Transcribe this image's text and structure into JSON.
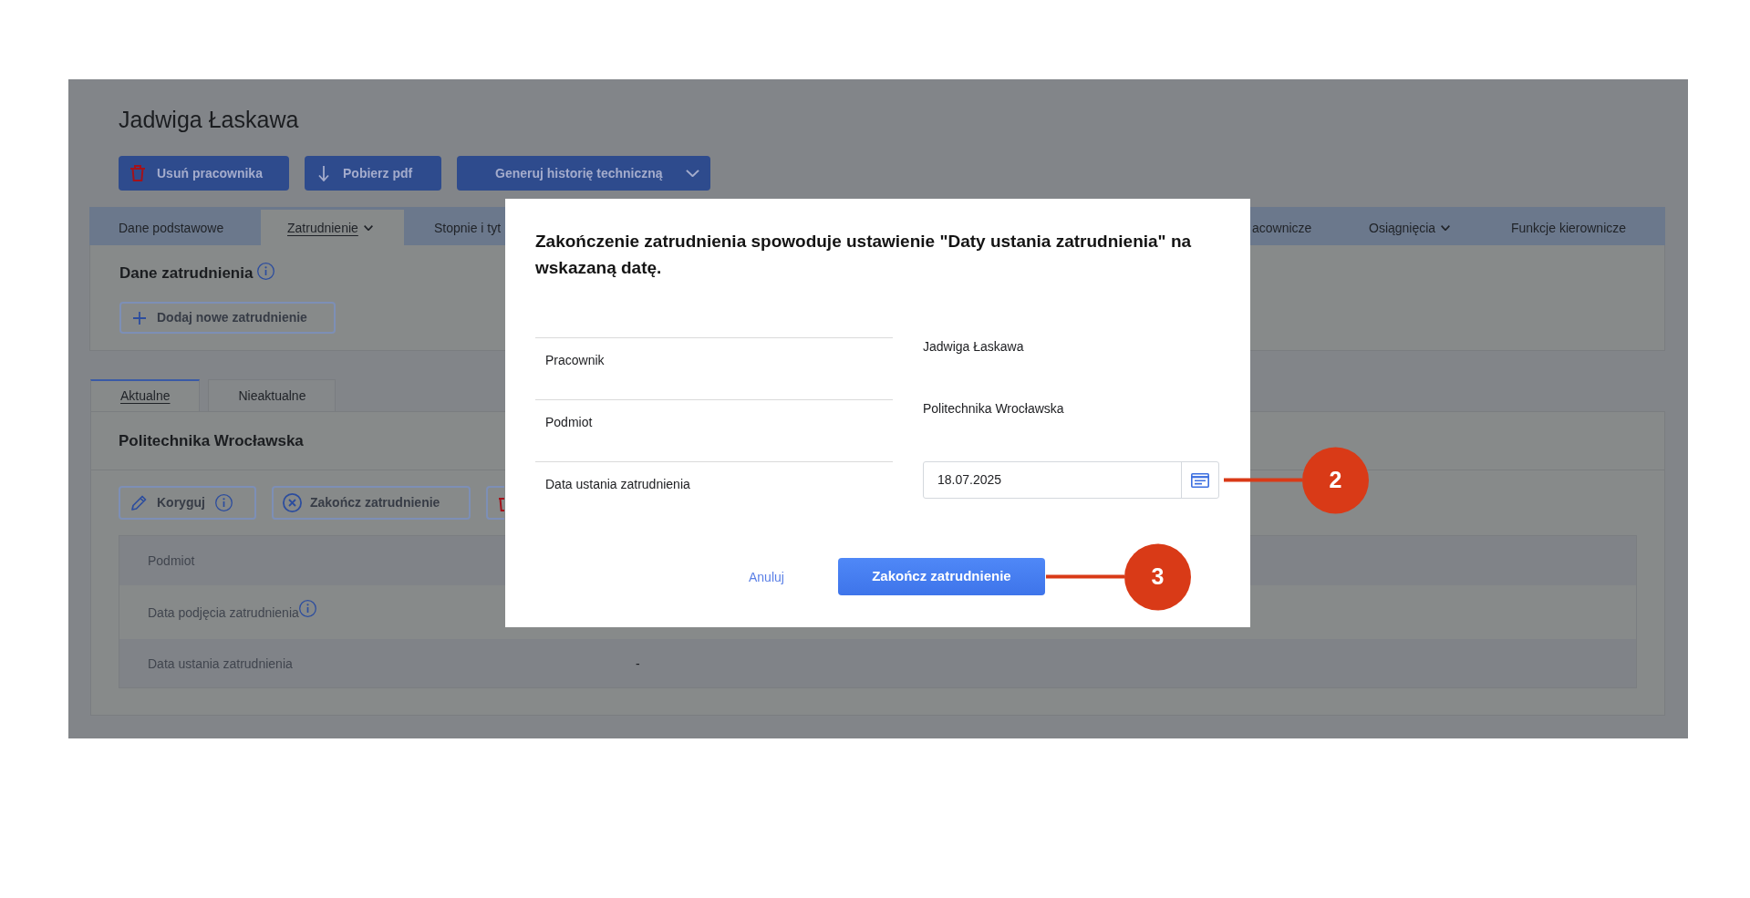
{
  "page": {
    "title": "Jadwiga Łaskawa",
    "actions": [
      {
        "kind": "delete",
        "label": "Usuń pracownika"
      },
      {
        "kind": "download",
        "label": "Pobierz pdf"
      },
      {
        "kind": "dropdown",
        "label": "Generuj historię techniczną"
      }
    ],
    "tab_bar": {
      "left": [
        {
          "label": "Dane podstawowe",
          "selected": false,
          "dropdown": false
        },
        {
          "label": "Zatrudnienie",
          "selected": true,
          "dropdown": true
        },
        {
          "label": "Stopnie i tyt",
          "selected": false,
          "dropdown": false
        }
      ],
      "right": [
        {
          "label": "acownicze",
          "selected": false,
          "dropdown": false
        },
        {
          "label": "Osiągnięcia",
          "selected": false,
          "dropdown": true
        },
        {
          "label": "Funkcje kierownicze",
          "selected": false,
          "dropdown": false
        }
      ]
    },
    "employment_section": {
      "title": "Dane zatrudnienia",
      "info": true,
      "add_button": "Dodaj nowe zatrudnienie"
    },
    "subtabs": [
      {
        "label": "Aktualne",
        "selected": true
      },
      {
        "label": "Nieaktualne",
        "selected": false
      }
    ],
    "employment_card": {
      "title": "Politechnika Wrocławska",
      "actions": [
        {
          "kind": "edit",
          "label": "Koryguj",
          "info": true
        },
        {
          "kind": "end",
          "label": "Zakończ zatrudnienie",
          "info": false
        },
        {
          "kind": "delete"
        }
      ],
      "rows": [
        {
          "label": "Podmiot",
          "info": false
        },
        {
          "label": "Data podjęcia zatrudnienia",
          "info": true
        },
        {
          "label": "Data ustania zatrudnienia",
          "info": false,
          "value": "-"
        }
      ]
    }
  },
  "dialog": {
    "message": "Zakończenie zatrudnienia spowoduje ustawienie \"Daty ustania zatrudnienia\" na wskazaną datę.",
    "fields": [
      {
        "kind": "text",
        "label": "Pracownik",
        "value": "Jadwiga Łaskawa"
      },
      {
        "kind": "text",
        "label": "Podmiot",
        "value": "Politechnika Wrocławska"
      },
      {
        "kind": "date",
        "label": "Data ustania zatrudnienia",
        "value": "18.07.2025",
        "callout": "2"
      }
    ],
    "cancel": "Anuluj",
    "confirm": {
      "label": "Zakończ zatrudnienie",
      "callout": "3"
    }
  }
}
